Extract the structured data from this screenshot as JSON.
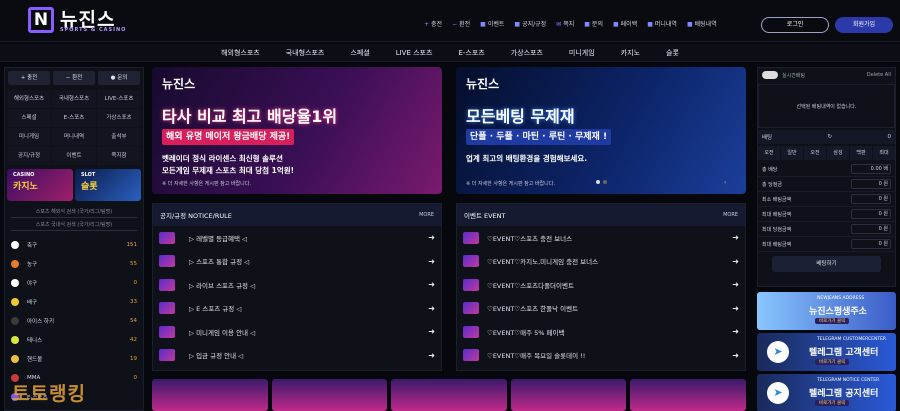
{
  "brand": {
    "name": "뉴진스",
    "sub": "SPORTS & CASINO",
    "mark": "N"
  },
  "topnav": [
    {
      "icon": "+",
      "label": "충전"
    },
    {
      "icon": "−",
      "label": "환전"
    },
    {
      "icon": "■",
      "label": "이벤트"
    },
    {
      "icon": "■",
      "label": "공지/규정"
    },
    {
      "icon": "✉",
      "label": "쪽지"
    },
    {
      "icon": "■",
      "label": "문의"
    },
    {
      "icon": "■",
      "label": "페이백"
    },
    {
      "icon": "■",
      "label": "머니내역"
    },
    {
      "icon": "■",
      "label": "배팅내역"
    }
  ],
  "auth": {
    "login": "로그인",
    "join": "회원가입"
  },
  "mainnav": [
    "해외형스포츠",
    "국내형스포츠",
    "스페셜",
    "LIVE 스포츠",
    "E-스포츠",
    "가상스포츠",
    "미니게임",
    "카지노",
    "슬롯"
  ],
  "left": {
    "buttons": [
      "+ 충전",
      "− 환전",
      "● 문의"
    ],
    "grid": [
      "해외형스포츠",
      "국내형스포츠",
      "LIVE-스포츠",
      "스페셜",
      "E-스포츠",
      "가상스포츠",
      "미니게임",
      "머니내역",
      "출석부",
      "공지/규정",
      "이벤트",
      "쪽지함"
    ],
    "promo_casino": "카지노",
    "promo_casino_tag": "CASINO",
    "promo_slot": "슬롯",
    "promo_slot_tag": "SLOT",
    "search1": "스포츠 해외식 검색 (국가/리그/팀명)",
    "search2": "스포츠 국내식 검색 (국가/리그/팀명)",
    "sports": [
      {
        "name": "축구",
        "count": "151",
        "color": "#ffffff"
      },
      {
        "name": "농구",
        "count": "55",
        "color": "#e87a2a"
      },
      {
        "name": "야구",
        "count": "0",
        "color": "#ffffff"
      },
      {
        "name": "배구",
        "count": "33",
        "color": "#f0c830"
      },
      {
        "name": "아이스 하키",
        "count": "54",
        "color": "#3a3a3a"
      },
      {
        "name": "테니스",
        "count": "42",
        "color": "#d8e83a"
      },
      {
        "name": "핸드볼",
        "count": "19",
        "color": "#e8c040"
      },
      {
        "name": "MMA",
        "count": "0",
        "color": "#c83a3a"
      },
      {
        "name": "E-스포츠",
        "count": "",
        "color": "#7a5ae8"
      }
    ],
    "watermark": "토토랭킹"
  },
  "banner1": {
    "logo": "뉴진스",
    "headline": "타사 비교 최고 배당율1위",
    "highlight": "해외 유명 메이저 왕금배당 제공!",
    "desc1": "벳레이더 정식 라이센스 최신형 솔루션",
    "desc2": "모든게임 무제재 스포츠 최대 당첨 1억원!",
    "note": "※ 더 자세한 사항은 게시판 참고 바랍니다."
  },
  "banner2": {
    "logo": "뉴진스",
    "headline": "모든베팅 무제재",
    "highlight": "단폴 · 두폴 · 마틴 · 루틴 · 무제재 !",
    "desc1": "업계 최고의 배팅환경을 경험해보세요.",
    "desc2": "",
    "note": "※ 더 자세한 사항은 게시판 참고 바랍니다."
  },
  "notice": {
    "title": "공지/규정 NOTICE/RULE",
    "more": "MORE",
    "items": [
      "▷ 레벨별 등급혜택 ◁",
      "▷ 스포츠 통합 규정 ◁",
      "▷ 라이브 스포츠 규정 ◁",
      "▷ E 스포츠 규정 ◁",
      "▷ 미니게임 이용 안내 ◁",
      "▷ 입금 규정 안내 ◁"
    ]
  },
  "event": {
    "title": "이벤트 EVENT",
    "more": "MORE",
    "items": [
      "♡EVENT♡스포츠 충전 보너스",
      "♡EVENT♡카지노,미니게임 충전 보너스",
      "♡EVENT♡스포츠다폴더이벤트",
      "♡EVENT♡스포츠 한폴낙 이벤트",
      "♡EVENT♡매주 5% 페이백",
      "♡EVENT♡매주 목요일 슬롯데이 !!"
    ]
  },
  "slip": {
    "live": "실시간배팅",
    "delete": "Delete All",
    "empty": "선택된 배팅내역이 없습니다.",
    "label": "배팅",
    "count": "0",
    "odds": [
      "오전",
      "일반",
      "오전",
      "삼성",
      "백판",
      "최대"
    ],
    "rows": [
      {
        "l": "총 배당",
        "v": "0.00 배"
      },
      {
        "l": "총 당첨금",
        "v": "0 원"
      },
      {
        "l": "최소 배팅금액",
        "v": "0 원"
      },
      {
        "l": "최대 배팅금액",
        "v": "0 원"
      },
      {
        "l": "최대 당첨금액",
        "v": "0 원"
      },
      {
        "l": "최대 배팅금액",
        "v": "0 원"
      }
    ],
    "button": "배팅하기"
  },
  "rbanners": [
    {
      "tag": "NEWJEANS ADDRESS",
      "title": "뉴진스평생주소",
      "sub": "바로가기 클릭"
    },
    {
      "tag": "TELEGRAM CUSTOMERCENTER",
      "title": "텔레그램 고객센터",
      "sub": "바로가기 클릭"
    },
    {
      "tag": "TELEGRAM NOTICE CENTER",
      "title": "텔레그램 공지센터",
      "sub": "바로가기 클릭"
    }
  ]
}
